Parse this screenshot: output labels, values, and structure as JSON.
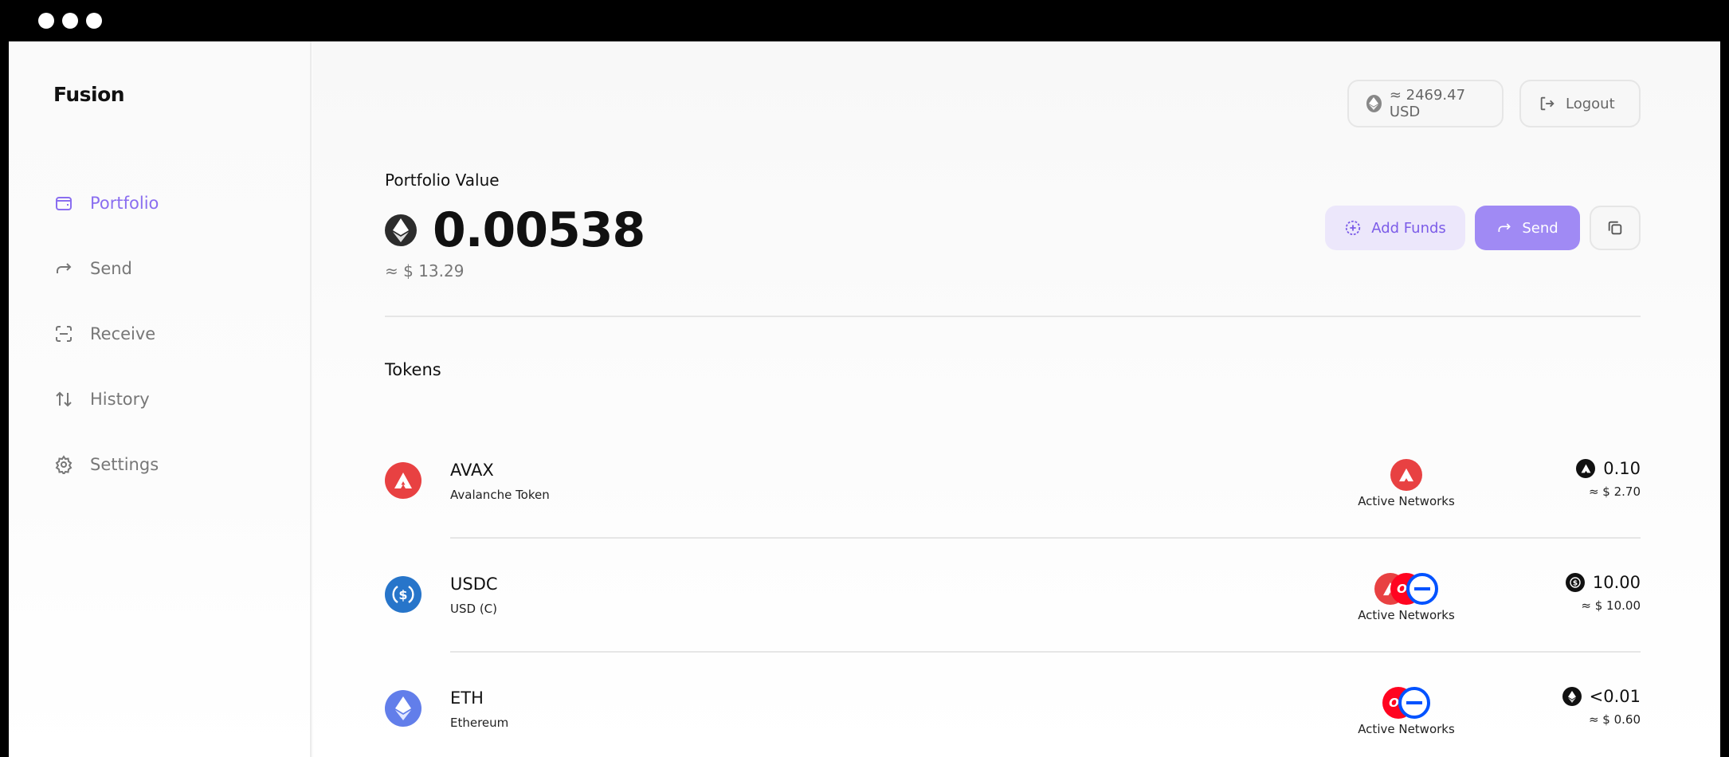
{
  "app": {
    "brand": "Fusion"
  },
  "sidebar": {
    "items": [
      {
        "label": "Portfolio",
        "icon": "wallet-icon",
        "active": true
      },
      {
        "label": "Send",
        "icon": "arrow-forward-icon"
      },
      {
        "label": "Receive",
        "icon": "scan-icon"
      },
      {
        "label": "History",
        "icon": "arrows-updown-icon"
      },
      {
        "label": "Settings",
        "icon": "gear-icon"
      }
    ]
  },
  "header": {
    "price": "≈ 2469.47 USD",
    "logout": "Logout"
  },
  "portfolio": {
    "label": "Portfolio Value",
    "value": "0.00538",
    "usd": "≈ $ 13.29"
  },
  "actions": {
    "add_funds": "Add Funds",
    "send": "Send"
  },
  "tokens": {
    "title": "Tokens",
    "network_label": "Active Networks",
    "rows": [
      {
        "symbol": "AVAX",
        "name": "Avalanche Token",
        "balance": "0.10",
        "usd": "≈ $ 2.70",
        "color": "#e84142",
        "networks": [
          "avalanche"
        ]
      },
      {
        "symbol": "USDC",
        "name": "USD (C)",
        "balance": "10.00",
        "usd": "≈ $ 10.00",
        "color": "#2775ca",
        "networks": [
          "avalanche",
          "optimism",
          "base"
        ]
      },
      {
        "symbol": "ETH",
        "name": "Ethereum",
        "balance": "<0.01",
        "usd": "≈ $ 0.60",
        "color": "#627eea",
        "networks": [
          "optimism",
          "base"
        ]
      }
    ]
  },
  "network_badges": {
    "optimism": "OP"
  },
  "colors": {
    "accent": "#8a6ef0",
    "send_button": "#a08af4",
    "add_funds_bg": "#ece7fb"
  }
}
